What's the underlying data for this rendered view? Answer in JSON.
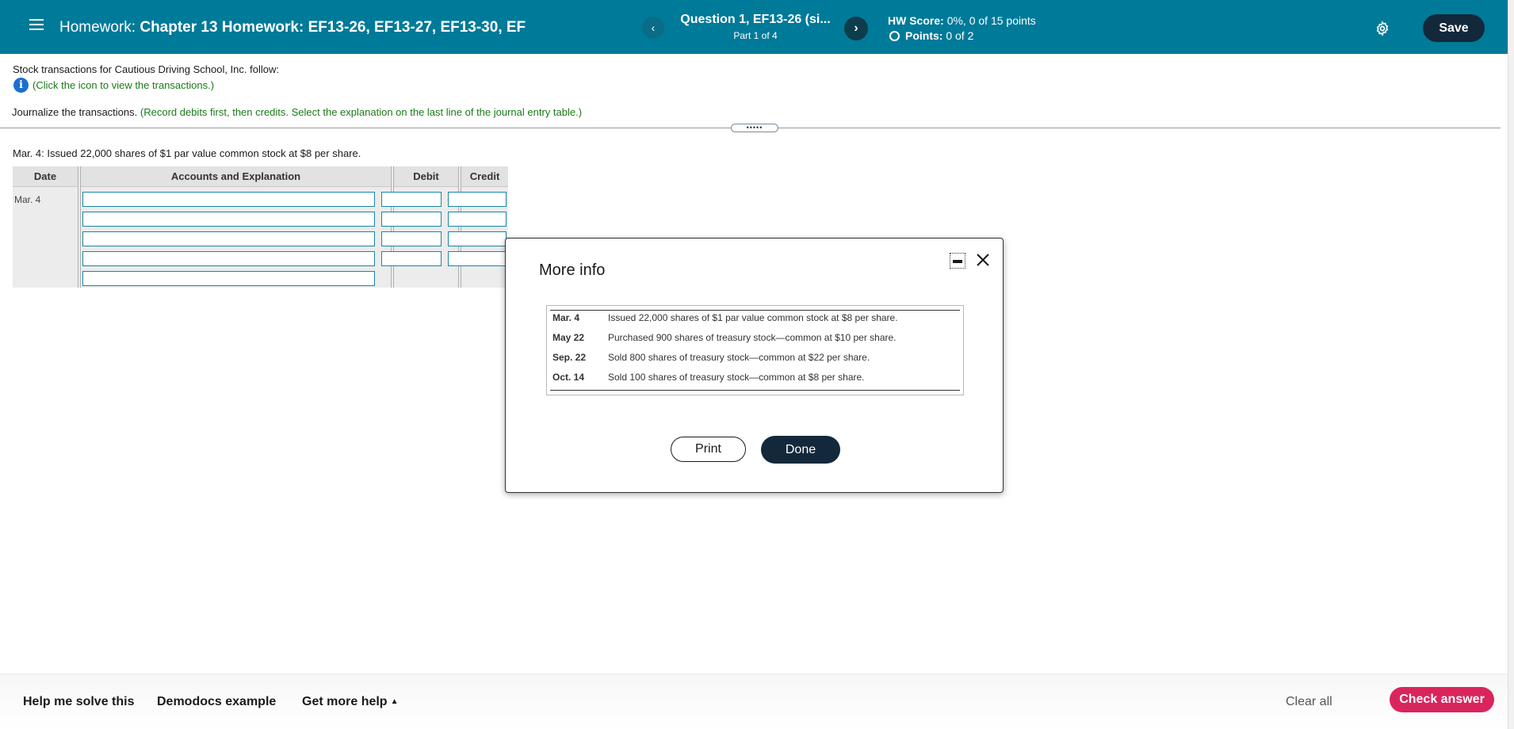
{
  "header": {
    "homework_prefix": "Homework:",
    "homework_title": "Chapter 13 Homework: EF13-26, EF13-27, EF13-30, EF",
    "question_title": "Question 1, EF13-26 (si...",
    "question_part": "Part 1 of 4",
    "prev_label": "‹",
    "next_label": "›",
    "score_label": "HW Score:",
    "score_value": "0%, 0 of 15 points",
    "points_label": "Points:",
    "points_value": "0 of 2",
    "save_label": "Save"
  },
  "question": {
    "intro": "Stock transactions for Cautious Driving School, Inc. follow:",
    "info_icon_glyph": "i",
    "info_hint": "(Click the icon to view the transactions.)",
    "journalize": "Journalize the transactions.",
    "journalize_hint": "(Record debits first, then credits. Select the explanation on the last line of the journal entry table.)",
    "drag_handle": "•••••",
    "transaction_label": "Mar. 4: Issued 22,000 shares of $1 par value common stock at $8 per share."
  },
  "journal": {
    "headers": [
      "Date",
      "Accounts and Explanation",
      "Debit",
      "Credit"
    ],
    "date": "Mar. 4"
  },
  "modal": {
    "title": "More info",
    "rows": [
      {
        "date": "Mar. 4",
        "text": "Issued 22,000 shares of $1 par value common stock at $8 per share."
      },
      {
        "date": "May 22",
        "text": "Purchased 900 shares of treasury stock—common at $10 per share."
      },
      {
        "date": "Sep. 22",
        "text": "Sold 800 shares of treasury stock—common at $22 per share."
      },
      {
        "date": "Oct. 14",
        "text": "Sold 100 shares of treasury stock—common at $8 per share."
      }
    ],
    "print_label": "Print",
    "done_label": "Done"
  },
  "footer": {
    "help_solve": "Help me solve this",
    "demodocs": "Demodocs example",
    "more_help": "Get more help",
    "more_help_caret": "▲",
    "clear_all": "Clear all",
    "check_answer": "Check answer"
  },
  "colors": {
    "header_bg": "#007a99",
    "dark_button": "#13283a",
    "hint_green": "#1a7a1a",
    "check_button": "#d9255b",
    "input_border": "#1687a7"
  }
}
